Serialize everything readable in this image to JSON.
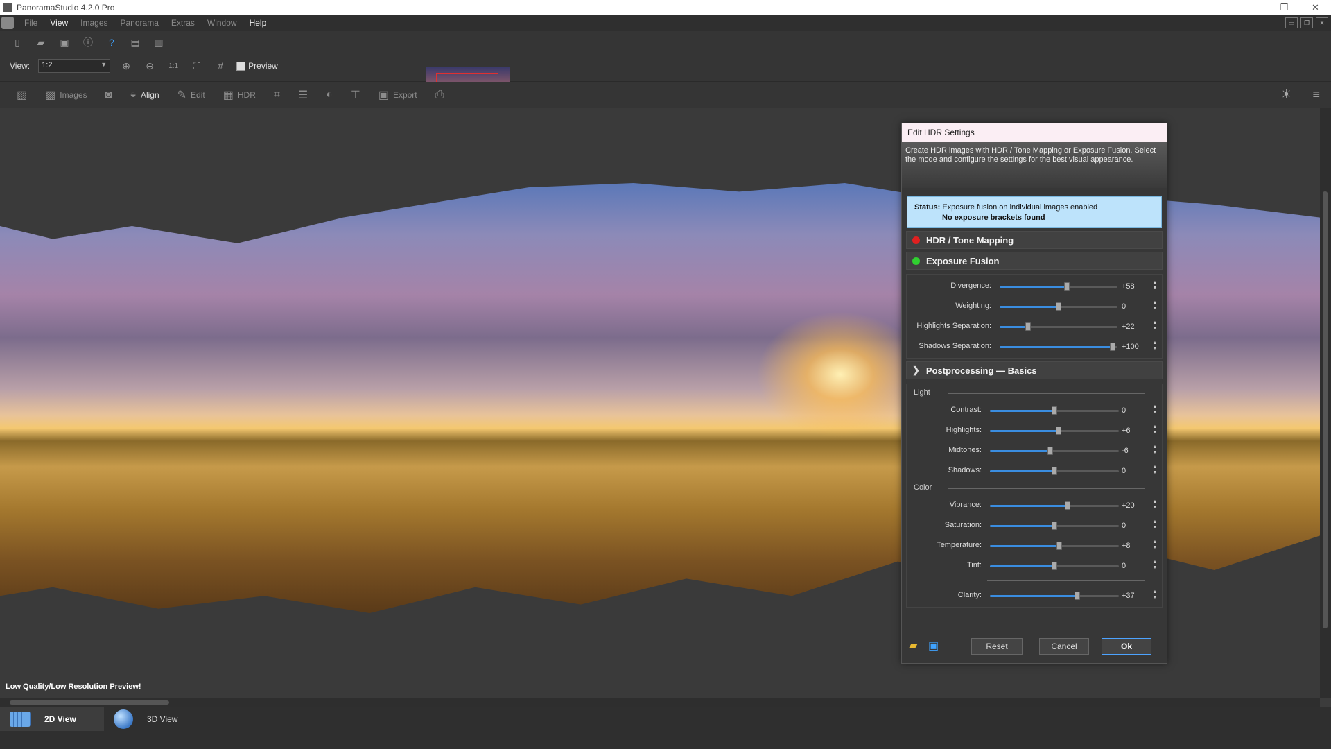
{
  "window": {
    "title": "PanoramaStudio 4.2.0 Pro",
    "minimize": "–",
    "restore": "❐",
    "close": "✕"
  },
  "menu": {
    "file": "File",
    "view": "View",
    "images": "Images",
    "panorama": "Panorama",
    "extras": "Extras",
    "window": "Window",
    "help": "Help"
  },
  "toolbar": {
    "view_label": "View:",
    "view_value": "1:2",
    "one_to_one": "1:1",
    "preview_label": "Preview"
  },
  "toolbar2": {
    "images": "Images",
    "align": "Align",
    "edit": "Edit",
    "hdr": "HDR",
    "export": "Export"
  },
  "canvas": {
    "preview_notice": "Low Quality/Low Resolution Preview!"
  },
  "tabs": {
    "view2d": "2D View",
    "view3d": "3D View"
  },
  "dialog": {
    "title": "Edit HDR Settings",
    "description": "Create HDR images with HDR / Tone Mapping or Exposure Fusion. Select the mode and configure the settings for the best visual appearance.",
    "status_label": "Status:",
    "status_line1": "Exposure fusion on individual images enabled",
    "status_line2": "No exposure brackets found",
    "sections": {
      "hdr": "HDR / Tone Mapping",
      "fusion": "Exposure Fusion",
      "post": "Postprocessing — Basics"
    },
    "groups": {
      "light": "Light",
      "color": "Color"
    },
    "fusion_sliders": [
      {
        "label": "Divergence:",
        "value": "+58",
        "fraction": 0.57
      },
      {
        "label": "Weighting:",
        "value": "0",
        "fraction": 0.5
      },
      {
        "label": "Highlights Separation:",
        "value": "+22",
        "fraction": 0.24
      },
      {
        "label": "Shadows Separation:",
        "value": "+100",
        "fraction": 0.96
      }
    ],
    "light_sliders": [
      {
        "label": "Contrast:",
        "value": "0",
        "fraction": 0.5
      },
      {
        "label": "Highlights:",
        "value": "+6",
        "fraction": 0.53
      },
      {
        "label": "Midtones:",
        "value": "-6",
        "fraction": 0.47
      },
      {
        "label": "Shadows:",
        "value": "0",
        "fraction": 0.5
      }
    ],
    "color_sliders": [
      {
        "label": "Vibrance:",
        "value": "+20",
        "fraction": 0.6
      },
      {
        "label": "Saturation:",
        "value": "0",
        "fraction": 0.5
      },
      {
        "label": "Temperature:",
        "value": "+8",
        "fraction": 0.54
      },
      {
        "label": "Tint:",
        "value": "0",
        "fraction": 0.5
      }
    ],
    "clarity_slider": {
      "label": "Clarity:",
      "value": "+37",
      "fraction": 0.68
    },
    "buttons": {
      "reset": "Reset",
      "cancel": "Cancel",
      "ok": "Ok"
    }
  },
  "colors": {
    "accent": "#3a8de0",
    "status_bg": "#bde3fb",
    "hdr_dot": "#e02020",
    "fusion_dot": "#30d030"
  }
}
